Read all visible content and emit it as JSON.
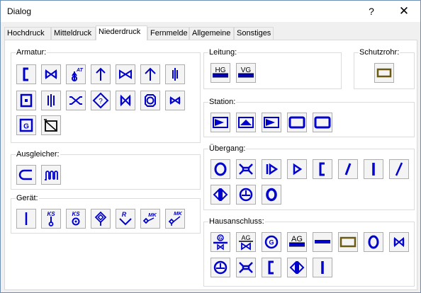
{
  "window": {
    "title": "Dialog",
    "help_glyph": "?",
    "close_glyph": "✕"
  },
  "tabs": [
    "Hochdruck",
    "Mitteldruck",
    "Niederdruck",
    "Fernmelde",
    "Allgemeine",
    "Sonstiges"
  ],
  "active_tab": "Niederdruck",
  "groups": {
    "armatur": "Armatur:",
    "ausgleicher": "Ausgleicher:",
    "geraet": "Gerät:",
    "leitung": "Leitung:",
    "schutzrohr": "Schutzrohr:",
    "station": "Station:",
    "uebergang": "Übergang:",
    "hausanschluss": "Hausanschluss:"
  },
  "symbol_text": {
    "at": "AT",
    "g": "G",
    "ks": "KS",
    "r": "R",
    "mk": "MK",
    "hg": "HG",
    "vg": "VG",
    "ag": "AG"
  },
  "colors": {
    "symbol_blue": "#0000cc",
    "schutzrohr_olive": "#6b5a12",
    "window_border": "#6d8fb5"
  },
  "icons": {
    "armatur": [
      "bracket-open-icon",
      "valve-bowtie-icon",
      "valve-actuator-at-icon",
      "arrow-up-icon",
      "valve-hollow-bowtie-icon",
      "arrow-up-open-icon",
      "double-bar-icon",
      "square-dot-icon",
      "triple-bar-icon",
      "valve-bracket-icon",
      "diamond-question-icon",
      "valve-bowtie-icon",
      "octagon-ring-icon",
      "valve-bowtie-small-icon",
      "gas-box-g-icon",
      "crossed-box-icon"
    ],
    "ausgleicher": [
      "u-bend-icon",
      "wave-compensator-icon"
    ],
    "geraet": [
      "vertical-line-icon",
      "ks-pin-icon",
      "ks-ring-icon",
      "diamond-target-icon",
      "r-chevron-icon",
      "mk-diamond-icon",
      "mk-angled-icon"
    ],
    "leitung": [
      "hg-line-icon",
      "vg-line-icon"
    ],
    "schutzrohr": [
      "protective-pipe-icon"
    ],
    "station": [
      "station-triangle-right-icon",
      "station-triangle-up-icon",
      "station-triangle-right-icon",
      "station-rect-icon",
      "station-rect-icon"
    ],
    "uebergang": [
      "ring-icon",
      "reducer-icon",
      "play-bar-icon",
      "play-outline-icon",
      "bracket-open-icon",
      "slash-icon",
      "vertical-bar-icon",
      "slash-thin-icon",
      "double-triangle-icon",
      "circle-cross-icon",
      "ring-small-icon"
    ],
    "hausanschluss": [
      "house-connection-g-icon",
      "ag-valve-icon",
      "circle-g-icon",
      "ag-line-icon",
      "blue-line-icon",
      "olive-rect-icon",
      "ring-icon",
      "valve-bowtie-icon",
      "circle-cross-icon",
      "reducer-icon",
      "bracket-open-icon",
      "double-triangle-icon",
      "vertical-bar-icon"
    ]
  }
}
